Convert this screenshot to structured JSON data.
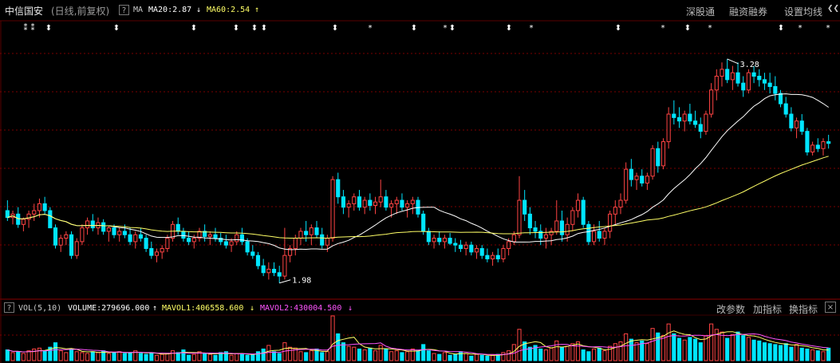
{
  "header": {
    "stock_name": "中信国安",
    "mode": "(日线,前复权)",
    "help_icon": "?",
    "indicator": "MA",
    "ma20_label": "MA20:2.87",
    "ma20_arrow": "↓",
    "ma60_label": "MA60:2.54",
    "ma60_arrow": "↑",
    "buttons": [
      "深股通",
      "融资融券",
      "设置均线"
    ],
    "chevron": "❮❮"
  },
  "price_chart": {
    "high_marker": "3.28",
    "low_marker": "1.98",
    "event_markers": [
      "⁑",
      "⁑",
      "⬍",
      "⬍",
      "⬍",
      "⬍",
      "⬍",
      "⬍",
      "⬍",
      "*",
      "⬍",
      "*",
      "⬍",
      "⬍",
      "*",
      "⬍",
      "*",
      "⬍",
      "*",
      "⬍",
      "*",
      "*"
    ]
  },
  "volume_panel": {
    "indicator": "VOL(5,10)",
    "volume_label": "VOLUME:279696.000",
    "volume_arrow": "↑",
    "mavol1_label": "MAVOL1:406558.600",
    "mavol1_arrow": "↓",
    "mavol2_label": "MAVOL2:430004.500",
    "mavol2_arrow": "↓",
    "buttons": [
      "改参数",
      "加指标",
      "换指标"
    ],
    "close_icon": "×"
  },
  "colors": {
    "up": "#ff4444",
    "down": "#00e5ff",
    "ma20": "#ffffff",
    "ma60": "#ffff66",
    "mavol1": "#ffff66",
    "mavol2": "#ff55ff",
    "grid": "#7a0000"
  },
  "chart_data": {
    "type": "candlestick",
    "ohlc": [
      [
        2.4,
        2.46,
        2.34,
        2.36
      ],
      [
        2.36,
        2.4,
        2.32,
        2.38
      ],
      [
        2.38,
        2.42,
        2.3,
        2.32
      ],
      [
        2.32,
        2.36,
        2.28,
        2.35
      ],
      [
        2.35,
        2.4,
        2.3,
        2.38
      ],
      [
        2.38,
        2.44,
        2.34,
        2.4
      ],
      [
        2.4,
        2.47,
        2.36,
        2.44
      ],
      [
        2.44,
        2.48,
        2.38,
        2.4
      ],
      [
        2.4,
        2.42,
        2.3,
        2.3
      ],
      [
        2.3,
        2.32,
        2.18,
        2.2
      ],
      [
        2.2,
        2.26,
        2.16,
        2.24
      ],
      [
        2.24,
        2.28,
        2.2,
        2.26
      ],
      [
        2.26,
        2.28,
        2.12,
        2.14
      ],
      [
        2.14,
        2.24,
        2.12,
        2.22
      ],
      [
        2.22,
        2.32,
        2.2,
        2.3
      ],
      [
        2.3,
        2.36,
        2.26,
        2.34
      ],
      [
        2.34,
        2.38,
        2.28,
        2.3
      ],
      [
        2.3,
        2.36,
        2.26,
        2.33
      ],
      [
        2.33,
        2.35,
        2.26,
        2.28
      ],
      [
        2.28,
        2.31,
        2.22,
        2.3
      ],
      [
        2.3,
        2.32,
        2.24,
        2.26
      ],
      [
        2.26,
        2.3,
        2.22,
        2.28
      ],
      [
        2.28,
        2.32,
        2.24,
        2.26
      ],
      [
        2.26,
        2.3,
        2.2,
        2.22
      ],
      [
        2.22,
        2.28,
        2.18,
        2.26
      ],
      [
        2.26,
        2.3,
        2.22,
        2.24
      ],
      [
        2.24,
        2.26,
        2.16,
        2.18
      ],
      [
        2.18,
        2.22,
        2.12,
        2.14
      ],
      [
        2.14,
        2.18,
        2.1,
        2.16
      ],
      [
        2.16,
        2.2,
        2.12,
        2.18
      ],
      [
        2.18,
        2.26,
        2.16,
        2.24
      ],
      [
        2.24,
        2.34,
        2.22,
        2.32
      ],
      [
        2.32,
        2.36,
        2.26,
        2.28
      ],
      [
        2.28,
        2.3,
        2.22,
        2.24
      ],
      [
        2.24,
        2.28,
        2.2,
        2.22
      ],
      [
        2.22,
        2.26,
        2.18,
        2.24
      ],
      [
        2.24,
        2.3,
        2.22,
        2.28
      ],
      [
        2.28,
        2.32,
        2.22,
        2.25
      ],
      [
        2.25,
        2.28,
        2.2,
        2.26
      ],
      [
        2.26,
        2.3,
        2.22,
        2.24
      ],
      [
        2.24,
        2.27,
        2.2,
        2.22
      ],
      [
        2.22,
        2.26,
        2.18,
        2.2
      ],
      [
        2.2,
        2.24,
        2.16,
        2.22
      ],
      [
        2.22,
        2.28,
        2.2,
        2.26
      ],
      [
        2.26,
        2.3,
        2.2,
        2.22
      ],
      [
        2.22,
        2.24,
        2.14,
        2.16
      ],
      [
        2.16,
        2.2,
        2.12,
        2.14
      ],
      [
        2.14,
        2.16,
        2.06,
        2.08
      ],
      [
        2.08,
        2.12,
        2.02,
        2.04
      ],
      [
        2.04,
        2.1,
        2.0,
        2.06
      ],
      [
        2.06,
        2.1,
        2.02,
        2.04
      ],
      [
        2.04,
        2.08,
        1.98,
        2.02
      ],
      [
        2.02,
        2.3,
        2.0,
        2.14
      ],
      [
        2.14,
        2.2,
        2.1,
        2.18
      ],
      [
        2.18,
        2.26,
        2.14,
        2.24
      ],
      [
        2.24,
        2.3,
        2.2,
        2.28
      ],
      [
        2.28,
        2.34,
        2.22,
        2.26
      ],
      [
        2.26,
        2.32,
        2.2,
        2.3
      ],
      [
        2.3,
        2.34,
        2.24,
        2.26
      ],
      [
        2.26,
        2.3,
        2.18,
        2.2
      ],
      [
        2.2,
        2.26,
        2.16,
        2.24
      ],
      [
        2.24,
        2.6,
        2.22,
        2.58
      ],
      [
        2.58,
        2.62,
        2.44,
        2.48
      ],
      [
        2.48,
        2.52,
        2.38,
        2.42
      ],
      [
        2.42,
        2.46,
        2.36,
        2.44
      ],
      [
        2.44,
        2.5,
        2.4,
        2.48
      ],
      [
        2.48,
        2.52,
        2.4,
        2.42
      ],
      [
        2.42,
        2.48,
        2.38,
        2.46
      ],
      [
        2.46,
        2.5,
        2.4,
        2.43
      ],
      [
        2.43,
        2.48,
        2.38,
        2.45
      ],
      [
        2.45,
        2.58,
        2.42,
        2.48
      ],
      [
        2.48,
        2.52,
        2.4,
        2.42
      ],
      [
        2.42,
        2.46,
        2.36,
        2.44
      ],
      [
        2.44,
        2.48,
        2.38,
        2.46
      ],
      [
        2.46,
        2.5,
        2.4,
        2.42
      ],
      [
        2.42,
        2.46,
        2.36,
        2.44
      ],
      [
        2.44,
        2.48,
        2.38,
        2.46
      ],
      [
        2.46,
        2.48,
        2.36,
        2.38
      ],
      [
        2.38,
        2.4,
        2.26,
        2.28
      ],
      [
        2.28,
        2.3,
        2.2,
        2.22
      ],
      [
        2.22,
        2.26,
        2.18,
        2.24
      ],
      [
        2.24,
        2.28,
        2.2,
        2.22
      ],
      [
        2.22,
        2.26,
        2.18,
        2.24
      ],
      [
        2.24,
        2.27,
        2.2,
        2.21
      ],
      [
        2.21,
        2.24,
        2.16,
        2.2
      ],
      [
        2.2,
        2.23,
        2.16,
        2.18
      ],
      [
        2.18,
        2.22,
        2.14,
        2.2
      ],
      [
        2.2,
        2.22,
        2.14,
        2.16
      ],
      [
        2.16,
        2.2,
        2.12,
        2.18
      ],
      [
        2.18,
        2.2,
        2.12,
        2.14
      ],
      [
        2.14,
        2.18,
        2.1,
        2.12
      ],
      [
        2.12,
        2.16,
        2.08,
        2.14
      ],
      [
        2.14,
        2.18,
        2.1,
        2.12
      ],
      [
        2.12,
        2.2,
        2.1,
        2.18
      ],
      [
        2.18,
        2.24,
        2.14,
        2.22
      ],
      [
        2.22,
        2.28,
        2.2,
        2.26
      ],
      [
        2.26,
        2.6,
        2.24,
        2.46
      ],
      [
        2.46,
        2.52,
        2.34,
        2.38
      ],
      [
        2.38,
        2.42,
        2.26,
        2.3
      ],
      [
        2.3,
        2.34,
        2.24,
        2.28
      ],
      [
        2.28,
        2.32,
        2.2,
        2.24
      ],
      [
        2.24,
        2.3,
        2.18,
        2.26
      ],
      [
        2.26,
        2.3,
        2.2,
        2.28
      ],
      [
        2.28,
        2.46,
        2.26,
        2.34
      ],
      [
        2.34,
        2.4,
        2.22,
        2.26
      ],
      [
        2.26,
        2.36,
        2.22,
        2.32
      ],
      [
        2.32,
        2.42,
        2.28,
        2.4
      ],
      [
        2.4,
        2.5,
        2.36,
        2.46
      ],
      [
        2.46,
        2.48,
        2.3,
        2.32
      ],
      [
        2.32,
        2.34,
        2.2,
        2.22
      ],
      [
        2.22,
        2.32,
        2.2,
        2.28
      ],
      [
        2.28,
        2.34,
        2.22,
        2.24
      ],
      [
        2.24,
        2.3,
        2.2,
        2.28
      ],
      [
        2.28,
        2.4,
        2.24,
        2.38
      ],
      [
        2.38,
        2.46,
        2.32,
        2.42
      ],
      [
        2.42,
        2.5,
        2.38,
        2.46
      ],
      [
        2.46,
        2.68,
        2.44,
        2.64
      ],
      [
        2.64,
        2.7,
        2.54,
        2.58
      ],
      [
        2.58,
        2.62,
        2.52,
        2.6
      ],
      [
        2.6,
        2.64,
        2.54,
        2.56
      ],
      [
        2.56,
        2.62,
        2.52,
        2.6
      ],
      [
        2.6,
        2.78,
        2.58,
        2.76
      ],
      [
        2.76,
        2.8,
        2.62,
        2.66
      ],
      [
        2.66,
        2.82,
        2.64,
        2.8
      ],
      [
        2.8,
        3.0,
        2.76,
        2.96
      ],
      [
        2.96,
        3.04,
        2.9,
        2.94
      ],
      [
        2.94,
        3.0,
        2.88,
        2.92
      ],
      [
        2.92,
        2.98,
        2.86,
        2.96
      ],
      [
        2.96,
        3.02,
        2.9,
        2.92
      ],
      [
        2.92,
        2.98,
        2.88,
        2.9
      ],
      [
        2.9,
        2.94,
        2.82,
        2.86
      ],
      [
        2.86,
        2.98,
        2.84,
        2.96
      ],
      [
        2.96,
        3.14,
        2.94,
        3.1
      ],
      [
        3.1,
        3.22,
        3.04,
        3.18
      ],
      [
        3.18,
        3.26,
        3.12,
        3.22
      ],
      [
        3.22,
        3.28,
        3.14,
        3.16
      ],
      [
        3.16,
        3.24,
        3.1,
        3.2
      ],
      [
        3.2,
        3.26,
        3.12,
        3.14
      ],
      [
        3.14,
        3.18,
        3.06,
        3.1
      ],
      [
        3.1,
        3.22,
        3.08,
        3.2
      ],
      [
        3.2,
        3.24,
        3.14,
        3.18
      ],
      [
        3.18,
        3.22,
        3.12,
        3.16
      ],
      [
        3.16,
        3.2,
        3.1,
        3.14
      ],
      [
        3.14,
        3.2,
        3.08,
        3.12
      ],
      [
        3.12,
        3.18,
        3.04,
        3.08
      ],
      [
        3.08,
        3.1,
        3.0,
        3.02
      ],
      [
        3.02,
        3.06,
        2.94,
        2.96
      ],
      [
        2.96,
        3.0,
        2.86,
        2.88
      ],
      [
        2.88,
        2.94,
        2.82,
        2.92
      ],
      [
        2.92,
        2.96,
        2.84,
        2.86
      ],
      [
        2.86,
        2.88,
        2.72,
        2.74
      ],
      [
        2.74,
        2.8,
        2.72,
        2.78
      ],
      [
        2.78,
        2.82,
        2.74,
        2.76
      ],
      [
        2.76,
        2.82,
        2.72,
        2.8
      ],
      [
        2.8,
        2.84,
        2.76,
        2.79
      ]
    ],
    "volume": [
      24,
      18,
      20,
      16,
      22,
      26,
      28,
      22,
      30,
      40,
      22,
      18,
      26,
      20,
      18,
      16,
      20,
      18,
      22,
      16,
      18,
      20,
      16,
      18,
      22,
      16,
      14,
      18,
      12,
      14,
      16,
      22,
      18,
      24,
      12,
      14,
      20,
      16,
      14,
      12,
      18,
      20,
      12,
      16,
      14,
      12,
      14,
      20,
      26,
      34,
      20,
      16,
      40,
      30,
      28,
      20,
      18,
      22,
      26,
      18,
      20,
      100,
      60,
      40,
      32,
      30,
      26,
      24,
      28,
      22,
      34,
      26,
      20,
      22,
      18,
      20,
      26,
      22,
      36,
      22,
      16,
      14,
      18,
      12,
      14,
      20,
      16,
      10,
      14,
      12,
      10,
      12,
      14,
      18,
      22,
      36,
      70,
      42,
      30,
      34,
      26,
      24,
      28,
      44,
      30,
      32,
      38,
      42,
      24,
      20,
      26,
      28,
      22,
      32,
      38,
      42,
      60,
      48,
      40,
      44,
      38,
      72,
      62,
      56,
      82,
      60,
      50,
      46,
      52,
      48,
      40,
      56,
      82,
      70,
      64,
      50,
      58,
      64,
      56,
      52,
      46,
      44,
      40,
      38,
      36,
      34,
      38,
      30,
      36,
      28,
      26,
      24,
      22,
      20,
      28
    ],
    "price_ylim": [
      1.9,
      3.4
    ],
    "volume_ylim": [
      0,
      100
    ],
    "ma20_last": 2.87,
    "ma60_last": 2.54,
    "last_volume": 279696.0,
    "mavol1_last": 406558.6,
    "mavol2_last": 430004.5,
    "xlabel": "",
    "ylabel": "",
    "grid": true
  }
}
